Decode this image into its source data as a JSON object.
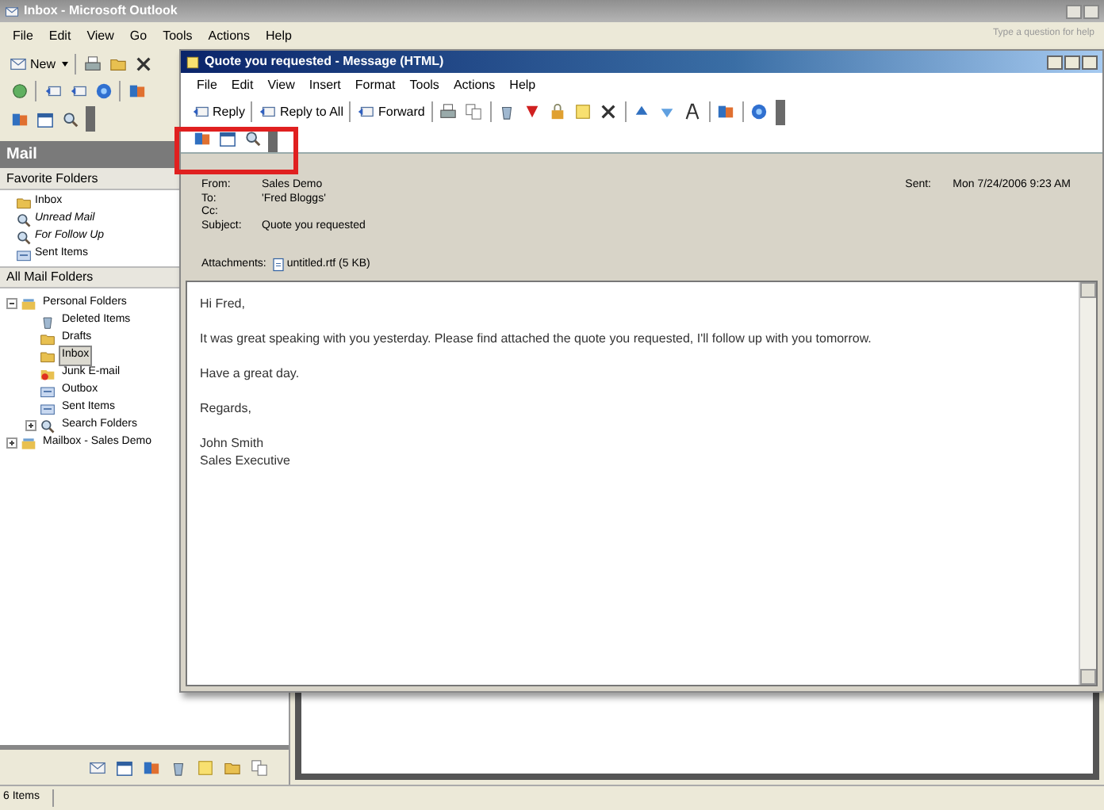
{
  "main_window": {
    "title": "Inbox - Microsoft Outlook",
    "menu": [
      "File",
      "Edit",
      "View",
      "Go",
      "Tools",
      "Actions",
      "Help"
    ],
    "help_box": "Type a question for help",
    "new_button": "New",
    "nav_title": "Mail",
    "favorites_header": "Favorite Folders",
    "favorites": [
      {
        "label": "Inbox",
        "kind": "folder"
      },
      {
        "label": "Unread Mail",
        "kind": "search"
      },
      {
        "label": "For Follow Up",
        "kind": "search"
      },
      {
        "label": "Sent Items",
        "kind": "sent"
      }
    ],
    "all_folders_header": "All Mail Folders",
    "folders": [
      {
        "label": "Personal Folders",
        "kind": "root",
        "expanded": true,
        "selected": false,
        "children": [
          {
            "label": "Deleted Items",
            "kind": "trash",
            "selected": false
          },
          {
            "label": "Drafts",
            "kind": "folder",
            "selected": false
          },
          {
            "label": "Inbox",
            "kind": "folder",
            "selected": true
          },
          {
            "label": "Junk E-mail",
            "kind": "junk",
            "selected": false
          },
          {
            "label": "Outbox",
            "kind": "sent",
            "selected": false
          },
          {
            "label": "Sent Items",
            "kind": "sent",
            "selected": false
          },
          {
            "label": "Search Folders",
            "kind": "search",
            "expanded": false,
            "selected": false
          }
        ]
      },
      {
        "label": "Mailbox - Sales Demo",
        "kind": "root",
        "expanded": false,
        "selected": false
      }
    ],
    "status_bar": "6 Items"
  },
  "message_window": {
    "title": "Quote you requested - Message (HTML)",
    "menu": [
      "File",
      "Edit",
      "View",
      "Insert",
      "Format",
      "Tools",
      "Actions",
      "Help"
    ],
    "toolbar": [
      "Reply",
      "Reply to All",
      "Forward"
    ],
    "fields": [
      {
        "label": "From:",
        "value": "Sales Demo"
      },
      {
        "label": "To:",
        "value": "'Fred Bloggs'"
      },
      {
        "label": "Cc:"
      },
      {
        "label": "Subject:",
        "value": "Quote you requested"
      }
    ],
    "sent": {
      "label": "Sent:",
      "value": "Mon 7/24/2006 9:23 AM"
    },
    "attachments": {
      "label": "Attachments:",
      "value": "untitled.rtf (5 KB)"
    },
    "body": [
      [
        "Hi Fred,"
      ],
      [
        "It was great speaking with you yesterday. Please find attached the quote you requested, I'll follow up with you tomorrow."
      ],
      [
        "Have a great day."
      ],
      [
        "Regards,"
      ],
      [
        "John Smith",
        "Sales Executive"
      ]
    ]
  }
}
